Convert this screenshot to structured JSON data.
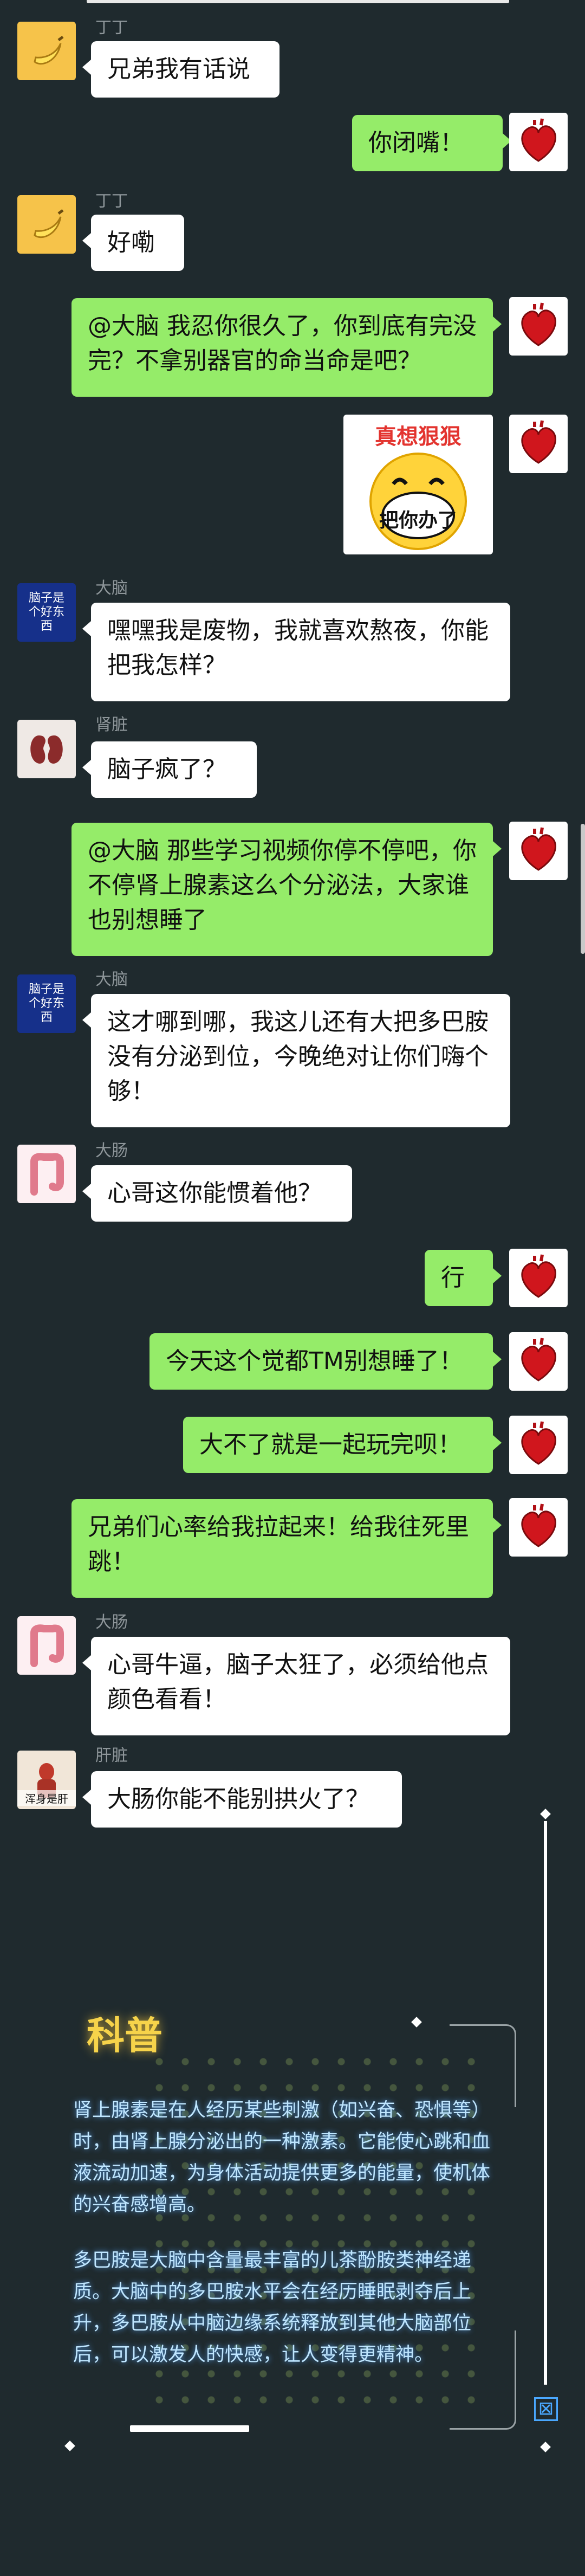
{
  "colors": {
    "background": "#1f2a2e",
    "green_bubble": "#95ec69",
    "white_bubble": "#ffffff",
    "name_text": "#8e969a",
    "science_text": "#bfe6ff",
    "science_title": "#f6d34a"
  },
  "messages": [
    {
      "name": "丁丁",
      "text": "兄弟我有话说"
    },
    {
      "name": "",
      "text": "你闭嘴！"
    },
    {
      "name": "丁丁",
      "text": "好嘞"
    },
    {
      "name": "",
      "text": "@大脑 我忍你很久了，你到底有完没完？不拿别器官的命当命是吧？"
    },
    {
      "name": "",
      "sticker_text": "真想狠狠",
      "sticker_sub": "把你办了"
    },
    {
      "name": "大脑",
      "text": "嘿嘿我是废物，我就喜欢熬夜，你能把我怎样？"
    },
    {
      "name": "肾脏",
      "text": "脑子疯了？"
    },
    {
      "name": "",
      "text": "@大脑 那些学习视频你停不停吧，你不停肾上腺素这么个分泌法，大家谁也别想睡了"
    },
    {
      "name": "大脑",
      "text": "这才哪到哪，我这儿还有大把多巴胺没有分泌到位，今晚绝对让你们嗨个够！"
    },
    {
      "name": "大肠",
      "text": "心哥这你能惯着他？"
    },
    {
      "name": "",
      "text": "行"
    },
    {
      "name": "",
      "text": "今天这个觉都TM别想睡了！"
    },
    {
      "name": "",
      "text": "大不了就是一起玩完呗！"
    },
    {
      "name": "",
      "text": "兄弟们心率给我拉起来！给我往死里跳！"
    },
    {
      "name": "大肠",
      "text": "心哥牛逼，脑子太狂了，必须给他点颜色看看！"
    },
    {
      "name": "肝脏",
      "text": "大肠你能不能别拱火了？"
    }
  ],
  "avatars": {
    "brain_label": "脑子是个好东西",
    "liver_label": "浑身是肝"
  },
  "science": {
    "title": "科普",
    "para1": "肾上腺素是在人经历某些刺激（如兴奋、恐惧等）时，由肾上腺分泌出的一种激素。它能使心跳和血液流动加速，为身体活动提供更多的能量，使机体的兴奋感增高。",
    "para2": "多巴胺是大脑中含量最丰富的儿茶酚胺类神经递质。大脑中的多巴胺水平会在经历睡眠剥夺后上升，多巴胺从中脑边缘系统释放到其他大脑部位后，可以激发人的快感，让人变得更精神。"
  },
  "controls": {
    "close_icon": "close-box-icon",
    "close_glyph": "⊠"
  }
}
